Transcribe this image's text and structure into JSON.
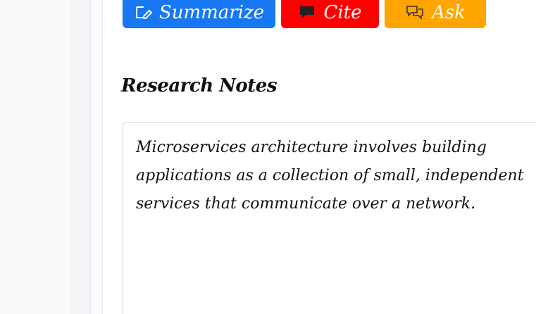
{
  "toolbar": {
    "summarize_label": "Summarize",
    "summarize_icon": "edit-icon",
    "cite_label": "Cite",
    "cite_icon": "comment-icon",
    "ask_label": "Ask",
    "ask_icon": "chat-bubbles-icon"
  },
  "colors": {
    "summarize": "#1877f2",
    "cite": "#ff0000",
    "ask": "#ffa500"
  },
  "notes": {
    "title": "Research Notes",
    "content": "Microservices architecture involves building applications as a collection of small, independent services that communicate over a network."
  }
}
